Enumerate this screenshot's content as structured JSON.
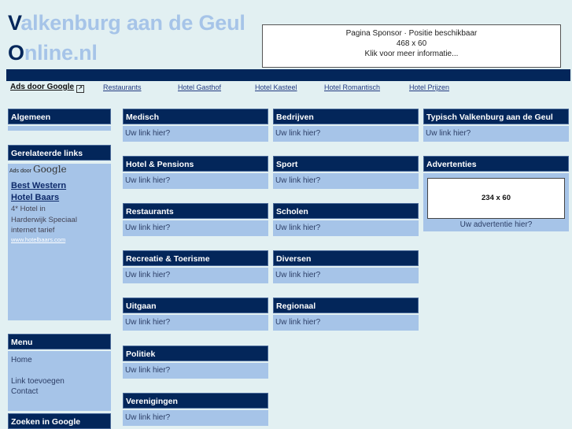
{
  "header": {
    "logo_line1_first": "V",
    "logo_line1_rest": "alkenburg aan de Geul",
    "logo_line2_first": "O",
    "logo_line2_rest": "nline.nl",
    "sponsor": {
      "line1": "Pagina Sponsor · Positie beschikbaar",
      "line2": "468 x 60",
      "line3": "Klik voor meer informatie..."
    }
  },
  "nav": {
    "ads_label": "Ads door Google",
    "ads_icon": "external-link-icon",
    "links": [
      "Restaurants",
      "Hotel Gasthof",
      "Hotel Kasteel",
      "Hotel Romantisch",
      "Hotel Prijzen"
    ]
  },
  "left": {
    "algemeen_title": "Algemeen",
    "related_title": "Gerelateerde links",
    "ads_prefix": "Ads door",
    "ads_brand": "Google",
    "ad": {
      "title_line1": "Best Western",
      "title_line2": "Hotel Baars",
      "text_line1": "4* Hotel in",
      "text_line2": "Harderwijk Speciaal",
      "text_line3": "internet tarief",
      "url": "www.hotelbaars.com"
    },
    "menu_title": "Menu",
    "menu_items": [
      "Home",
      "Link toevoegen",
      "Contact"
    ],
    "search_title": "Zoeken in Google"
  },
  "categories": {
    "link_text": "Uw link hier?",
    "col1": [
      "Medisch",
      "Hotel & Pensions",
      "Restaurants",
      "Recreatie & Toerisme",
      "Uitgaan",
      "Politiek",
      "Verenigingen"
    ],
    "col2": [
      "Bedrijven",
      "Sport",
      "Scholen",
      "Diversen",
      "Regionaal"
    ]
  },
  "right": {
    "typisch_title": "Typisch Valkenburg aan de Geul",
    "typisch_link": "Uw link hier?",
    "ads_title": "Advertenties",
    "ad_size": "234 x 60",
    "ad_caption": "Uw advertentie hier?"
  },
  "colors": {
    "background": "#e2f0f2",
    "navy": "#03265a",
    "light_blue": "#a6c4e8"
  }
}
